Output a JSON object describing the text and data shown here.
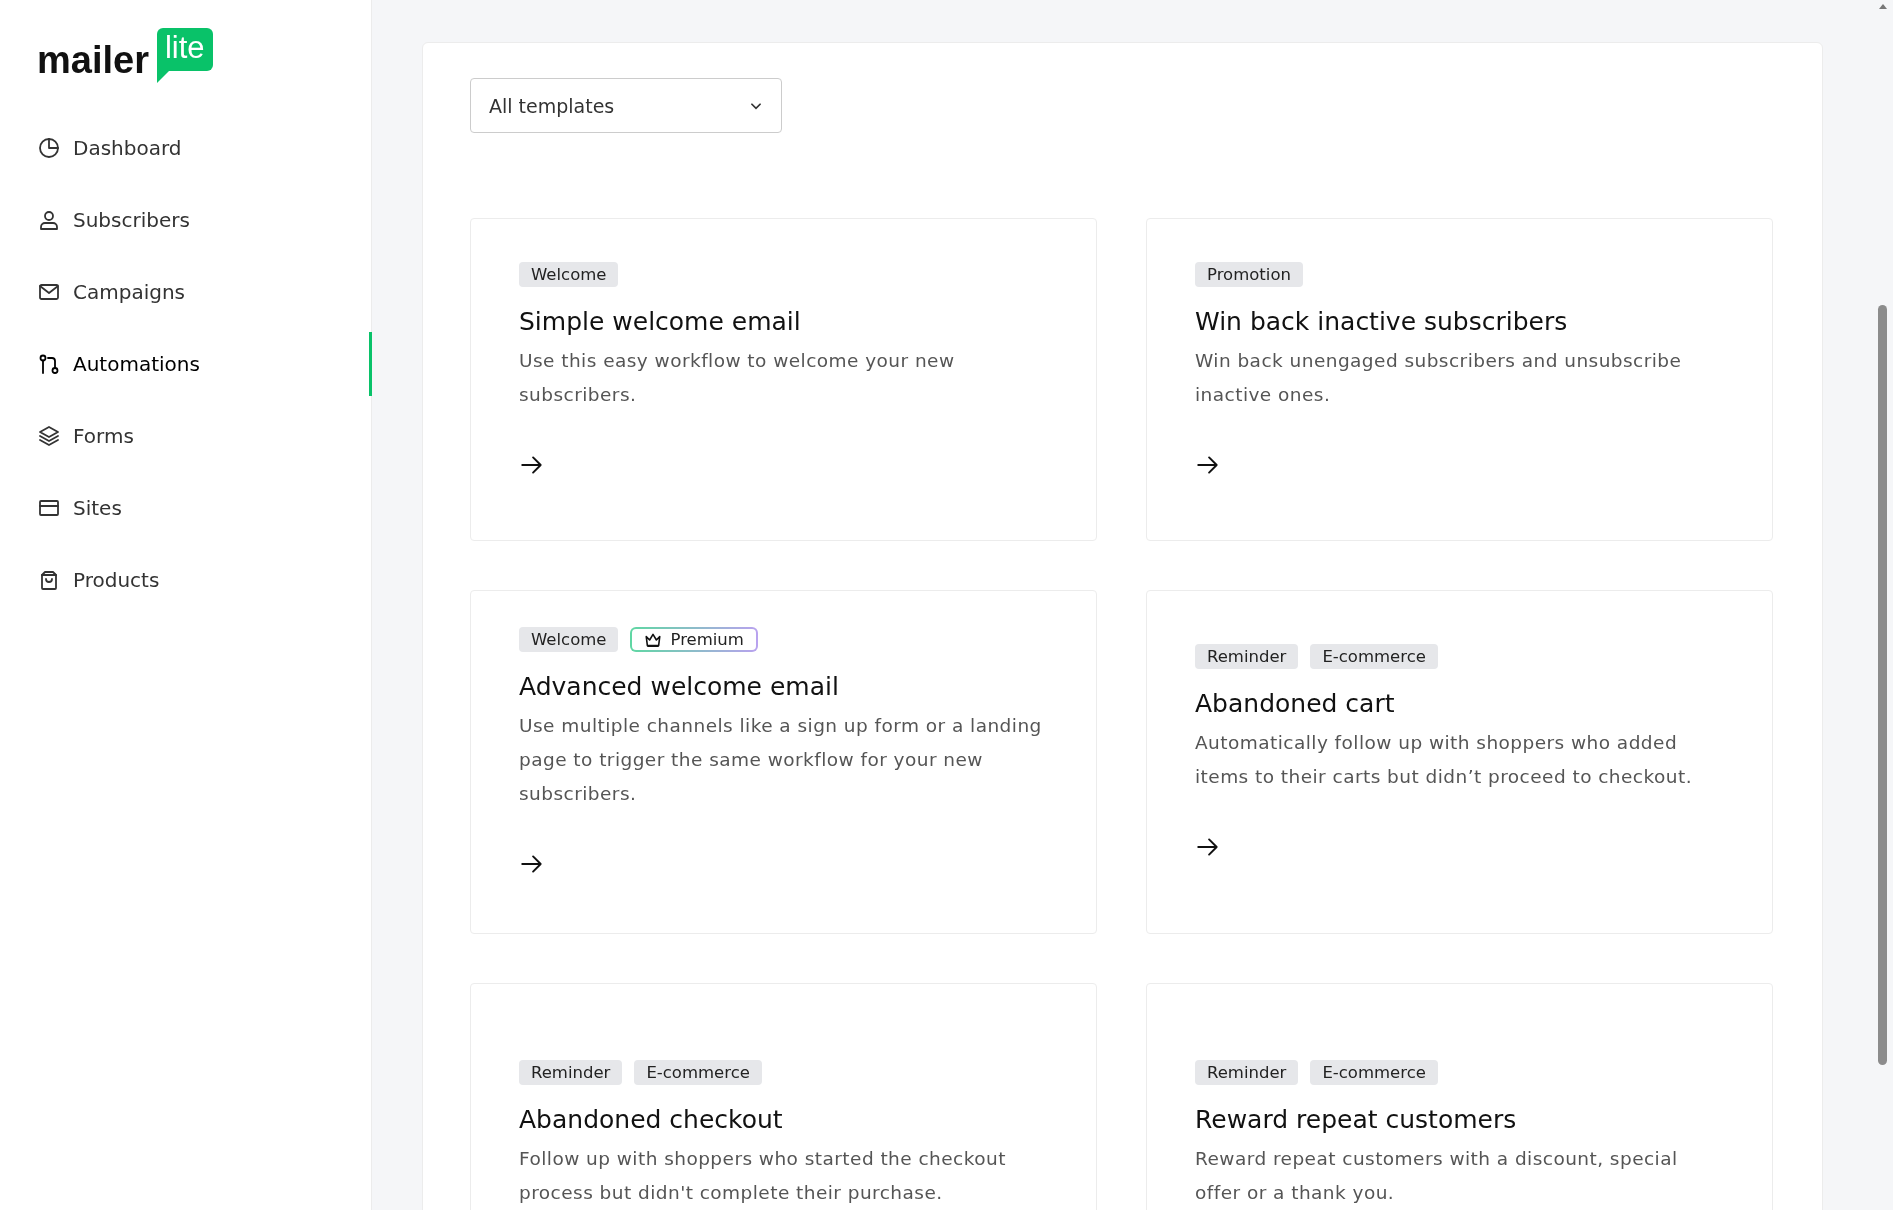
{
  "logo": {
    "word": "mailer",
    "badge": "lite"
  },
  "sidebar": {
    "items": [
      {
        "label": "Dashboard",
        "selected": false
      },
      {
        "label": "Subscribers",
        "selected": false
      },
      {
        "label": "Campaigns",
        "selected": false
      },
      {
        "label": "Automations",
        "selected": true
      },
      {
        "label": "Forms",
        "selected": false
      },
      {
        "label": "Sites",
        "selected": false
      },
      {
        "label": "Products",
        "selected": false
      }
    ]
  },
  "filter": {
    "value": "All templates"
  },
  "templates": [
    {
      "tags": [
        {
          "label": "Welcome",
          "kind": "plain"
        }
      ],
      "title": "Simple welcome email",
      "description": "Use this easy workflow to welcome your new subscribers.",
      "arrow": true
    },
    {
      "tags": [
        {
          "label": "Promotion",
          "kind": "plain"
        }
      ],
      "title": "Win back inactive subscribers",
      "description": "Win back unengaged subscribers and unsubscribe inactive ones.",
      "arrow": true
    },
    {
      "tags": [
        {
          "label": "Welcome",
          "kind": "plain"
        },
        {
          "label": "Premium",
          "kind": "premium"
        }
      ],
      "title": "Advanced welcome email",
      "description": "Use multiple channels like a sign up form or a landing page to trigger the same workflow for your new subscribers.",
      "arrow": true
    },
    {
      "tags": [
        {
          "label": "Reminder",
          "kind": "plain"
        },
        {
          "label": "E-commerce",
          "kind": "plain"
        }
      ],
      "title": "Abandoned cart",
      "description": "Automatically follow up with shoppers who added items to their carts but didn’t proceed to checkout.",
      "arrow": true
    },
    {
      "tags": [
        {
          "label": "Reminder",
          "kind": "plain"
        },
        {
          "label": "E-commerce",
          "kind": "plain"
        }
      ],
      "title": "Abandoned checkout",
      "description": "Follow up with shoppers who started the checkout process but didn't complete their purchase.",
      "arrow": false
    },
    {
      "tags": [
        {
          "label": "Reminder",
          "kind": "plain"
        },
        {
          "label": "E-commerce",
          "kind": "plain"
        }
      ],
      "title": "Reward repeat customers",
      "description": "Reward repeat customers with a discount, special offer or a thank you.",
      "arrow": false
    }
  ]
}
